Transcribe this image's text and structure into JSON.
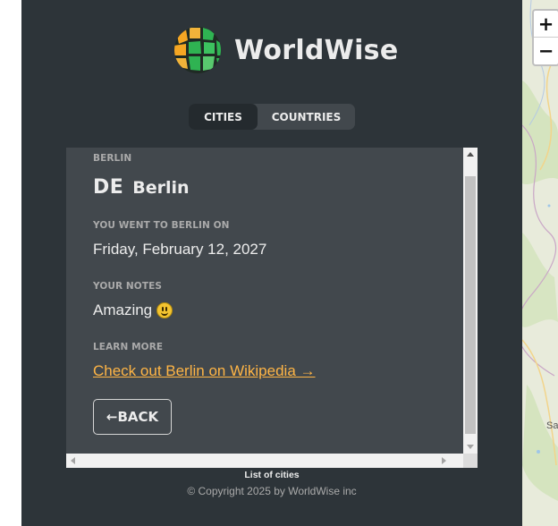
{
  "app": {
    "name": "WorldWise"
  },
  "tabs": [
    {
      "label": "CITIES",
      "active": true
    },
    {
      "label": "COUNTRIES",
      "active": false
    }
  ],
  "city": {
    "section_label": "Berlin",
    "flag": "DE",
    "name": "Berlin",
    "went_label": "You went to Berlin on",
    "date": "Friday, February 12, 2027",
    "notes_label": "Your notes",
    "notes": "Amazing",
    "notes_emoji": "grinning-face-emoji",
    "learn_label": "Learn more",
    "wiki_link": "Check out Berlin on Wikipedia →",
    "back_label": "←BACK"
  },
  "footer": {
    "list_title": "List of cities",
    "copyright": "© Copyright 2025 by WorldWise inc"
  },
  "map": {
    "zoom_in": "+",
    "zoom_out": "−",
    "partial_label": "Sa"
  },
  "colors": {
    "sidebar_bg": "#2d3439",
    "panel_bg": "#42484d",
    "link": "#ffb545",
    "brand_green": "#2fb352",
    "brand_orange": "#f5a623"
  }
}
